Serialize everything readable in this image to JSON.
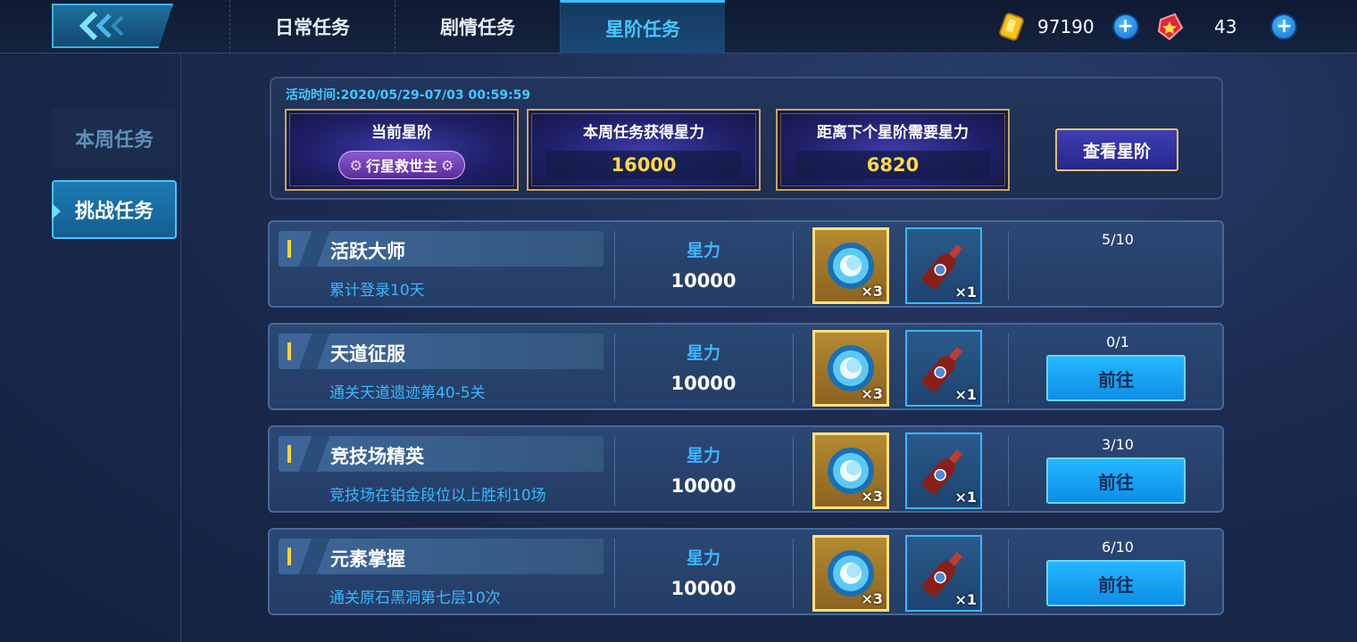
{
  "tabs": [
    {
      "label": "日常任务"
    },
    {
      "label": "剧情任务"
    },
    {
      "label": "星阶任务"
    }
  ],
  "currency": {
    "gold": "97190",
    "gems": "43",
    "plus": "+"
  },
  "sidebar": {
    "items": [
      {
        "label": "本周任务"
      },
      {
        "label": "挑战任务"
      }
    ]
  },
  "summary": {
    "activity_time": "活动时间:2020/05/29-07/03 00:59:59",
    "current_rank": {
      "title": "当前星阶",
      "rank": "行星救世主"
    },
    "weekly_star": {
      "title": "本周任务获得星力",
      "value": "16000"
    },
    "next_rank": {
      "title": "距离下个星阶需要星力",
      "value": "6820"
    },
    "view_button": "查看星阶"
  },
  "tasks": [
    {
      "title": "活跃大师",
      "desc": "累计登录10天",
      "star_label": "星力",
      "star_value": "10000",
      "reward1_qty": "×3",
      "reward2_qty": "×1",
      "progress": "5/10",
      "button": ""
    },
    {
      "title": "天道征服",
      "desc": "通关天道遗迹第40-5关",
      "star_label": "星力",
      "star_value": "10000",
      "reward1_qty": "×3",
      "reward2_qty": "×1",
      "progress": "0/1",
      "button": "前往"
    },
    {
      "title": "竞技场精英",
      "desc": "竞技场在铂金段位以上胜利10场",
      "star_label": "星力",
      "star_value": "10000",
      "reward1_qty": "×3",
      "reward2_qty": "×1",
      "progress": "3/10",
      "button": "前往"
    },
    {
      "title": "元素掌握",
      "desc": "通关原石黑洞第七层10次",
      "star_label": "星力",
      "star_value": "10000",
      "reward1_qty": "×3",
      "reward2_qty": "×1",
      "progress": "6/10",
      "button": "前往"
    }
  ],
  "colors": {
    "accent": "#43c8ff",
    "gold_text": "#ffd84a",
    "button": "#1aa6f5"
  }
}
